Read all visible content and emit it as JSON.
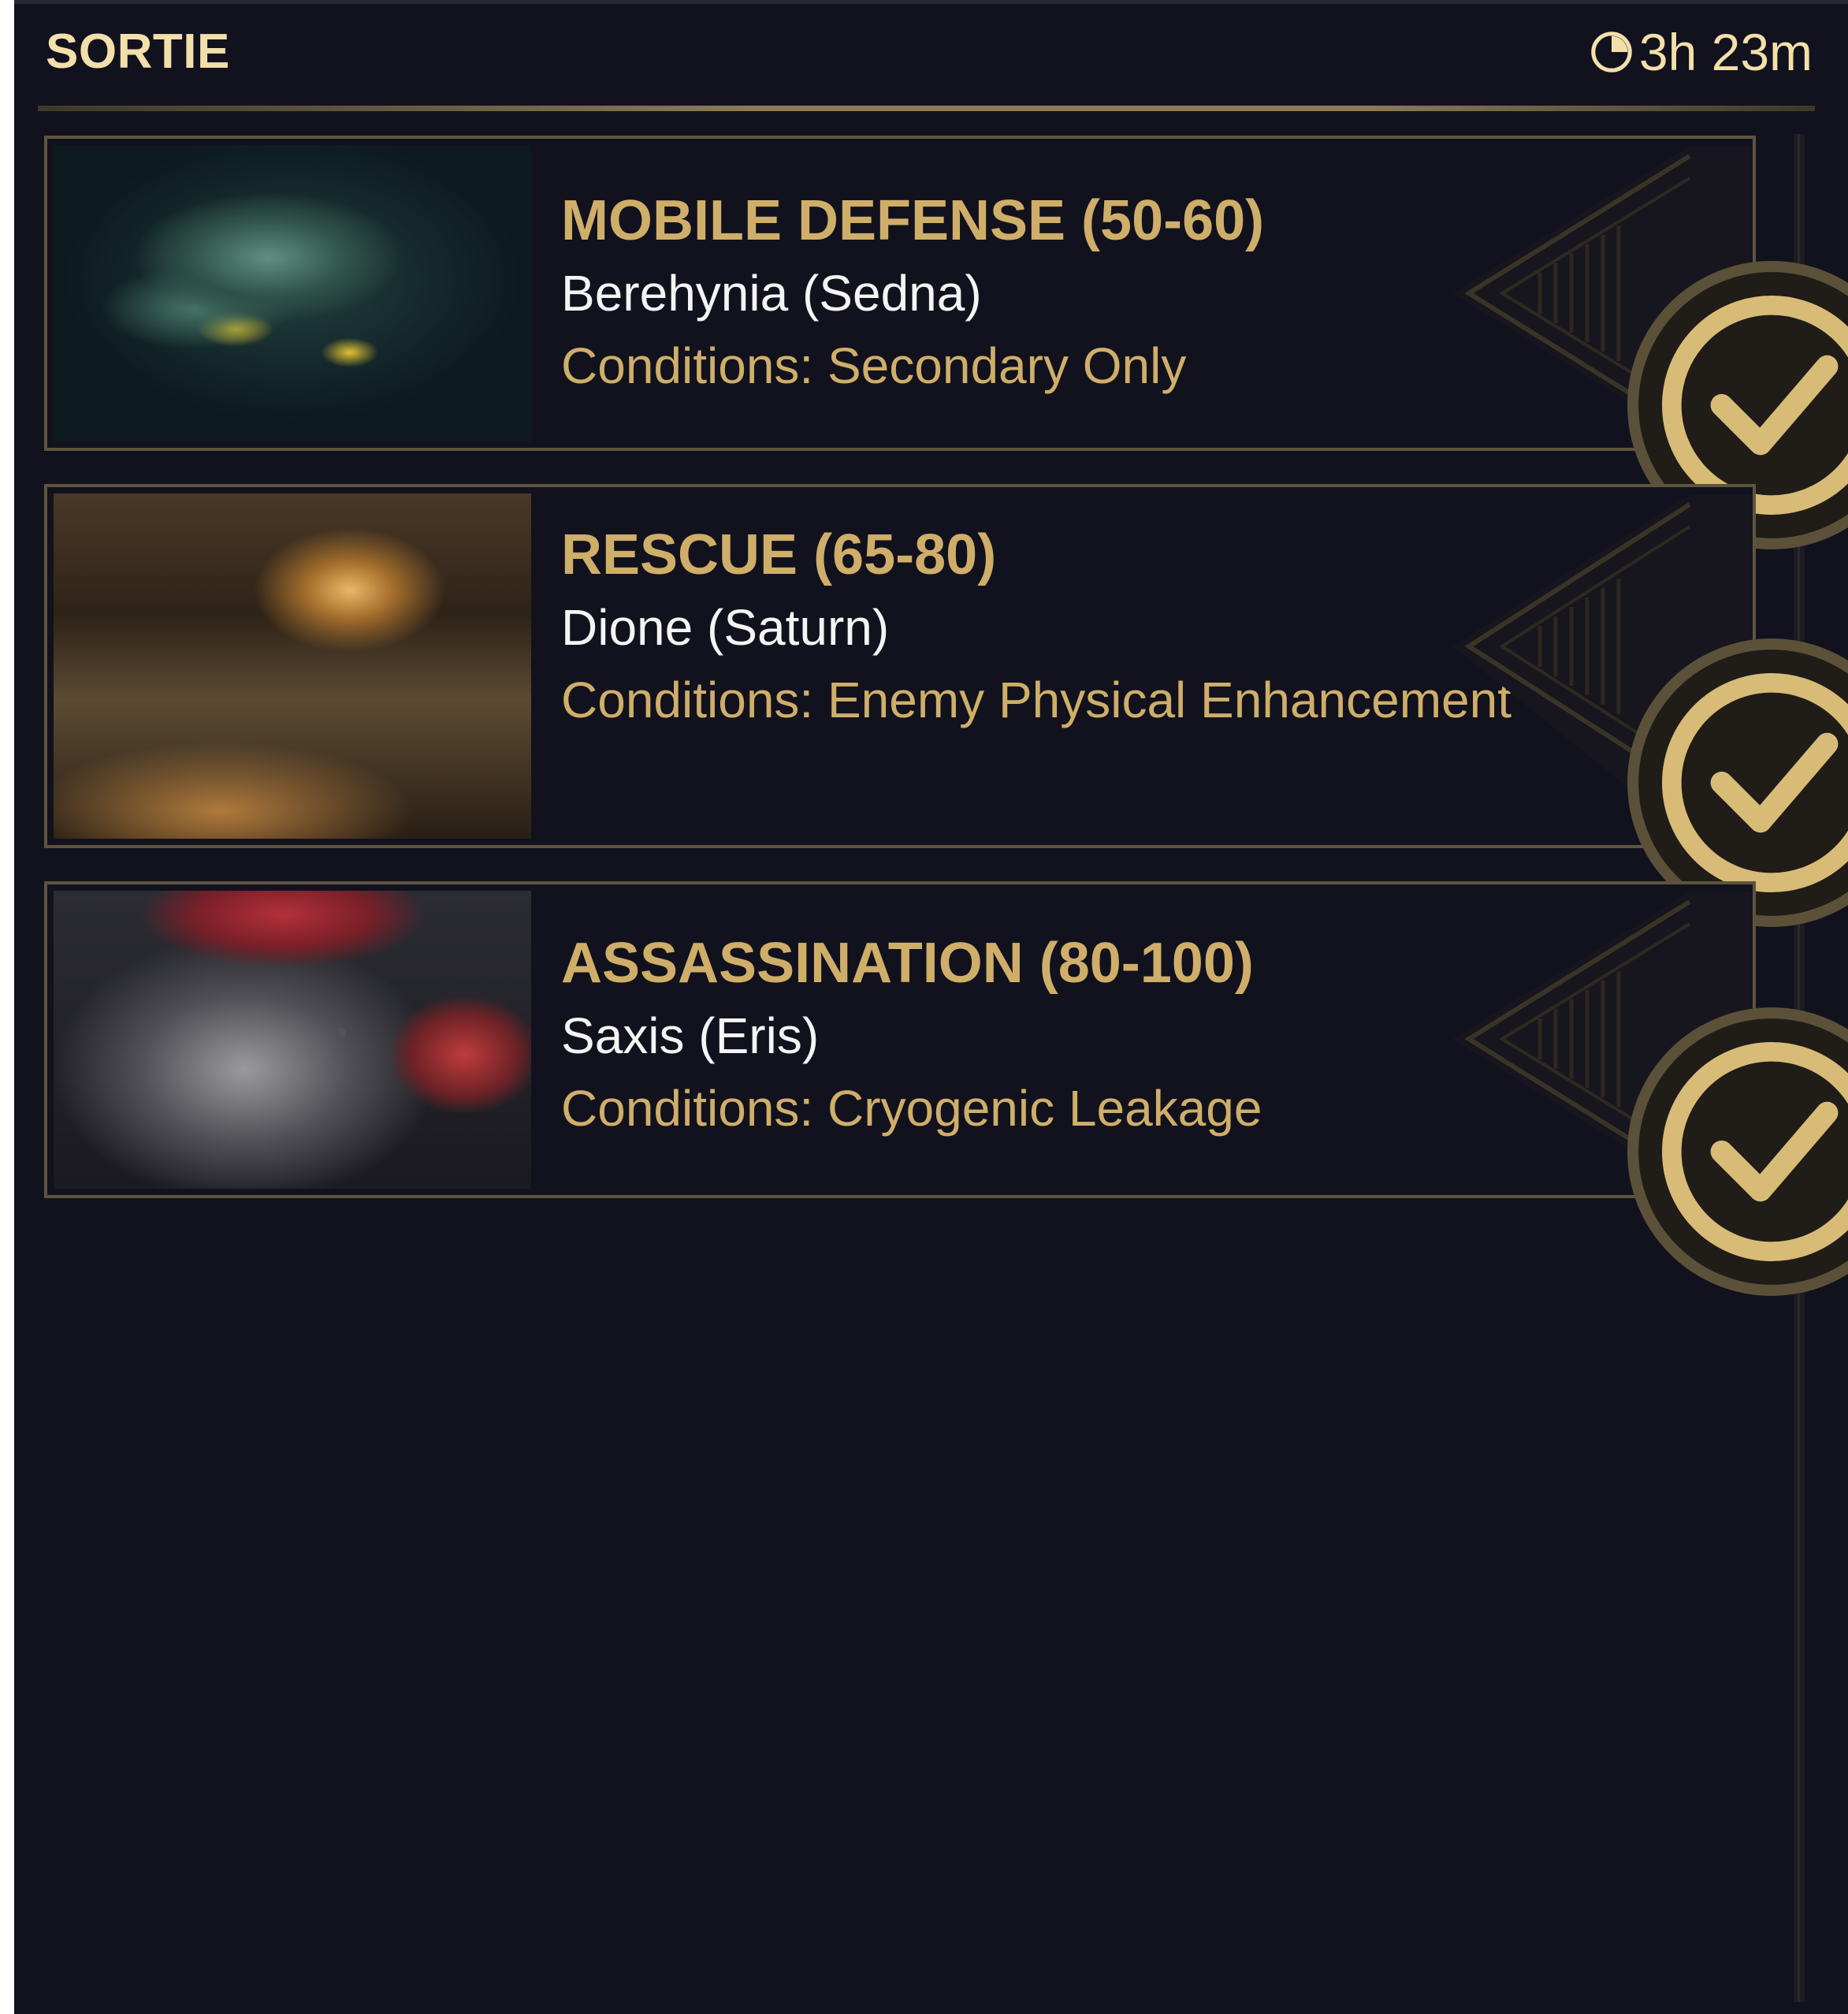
{
  "header": {
    "title": "SORTIE",
    "timer": "3h 23m",
    "timer_icon": "clock-icon"
  },
  "missions": [
    {
      "name": "MOBILE DEFENSE (50-60)",
      "node": "Berehynia (Sedna)",
      "conditions": "Conditions: Secondary Only",
      "status_icon": "check-circle-icon"
    },
    {
      "name": "RESCUE (65-80)",
      "node": "Dione (Saturn)",
      "conditions": "Conditions: Enemy Physical Enhancement",
      "status_icon": "check-circle-icon"
    },
    {
      "name": "ASSASSINATION (80-100)",
      "node": "Saxis (Eris)",
      "conditions": "Conditions: Cryogenic Leakage",
      "status_icon": "check-circle-icon"
    }
  ],
  "colors": {
    "background": "#12121e",
    "accent_gold": "#cfae69",
    "title_cream": "#f2dfaa",
    "border": "#5e543e"
  }
}
